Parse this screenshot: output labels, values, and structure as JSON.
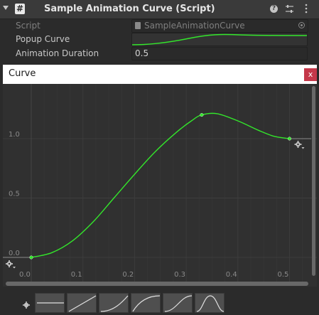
{
  "inspector": {
    "component_title": "Sample Animation Curve (Script)",
    "icons": {
      "collapse": "triangle-down-icon",
      "script": "script-hash-icon",
      "help": "help-icon",
      "presets": "presets-sliders-icon",
      "menu": "kebab-menu-icon"
    }
  },
  "properties": {
    "script_label": "Script",
    "script_value": "SampleAnimationCurve",
    "popup_curve_label": "Popup Curve",
    "duration_label": "Animation Duration",
    "duration_value": "0.5"
  },
  "curve_window": {
    "title": "Curve",
    "close_label": "x",
    "curve_color": "#33e62b"
  },
  "chart_data": {
    "type": "line",
    "x_ticks": [
      "0.0",
      "0.1",
      "0.2",
      "0.3",
      "0.4",
      "0.5"
    ],
    "y_ticks": [
      "0.0",
      "0.5",
      "1.0"
    ],
    "xlim": [
      -0.03,
      0.56
    ],
    "ylim": [
      -0.05,
      1.48
    ],
    "keyframes": [
      {
        "x": 0.0,
        "y": 0.0
      },
      {
        "x": 0.33,
        "y": 1.2
      },
      {
        "x": 0.5,
        "y": 1.0
      }
    ],
    "points": [
      {
        "x": 0.0,
        "y": 0.0
      },
      {
        "x": 0.04,
        "y": 0.04
      },
      {
        "x": 0.08,
        "y": 0.14
      },
      {
        "x": 0.12,
        "y": 0.3
      },
      {
        "x": 0.16,
        "y": 0.5
      },
      {
        "x": 0.2,
        "y": 0.7
      },
      {
        "x": 0.24,
        "y": 0.89
      },
      {
        "x": 0.28,
        "y": 1.05
      },
      {
        "x": 0.31,
        "y": 1.15
      },
      {
        "x": 0.33,
        "y": 1.2
      },
      {
        "x": 0.36,
        "y": 1.21
      },
      {
        "x": 0.4,
        "y": 1.15
      },
      {
        "x": 0.44,
        "y": 1.07
      },
      {
        "x": 0.47,
        "y": 1.02
      },
      {
        "x": 0.5,
        "y": 1.0
      }
    ]
  },
  "presets": {
    "items": [
      "flat",
      "linear",
      "ease-in",
      "ease-out",
      "ease-in-out",
      "bell"
    ],
    "gear_icon": "gear-icon"
  }
}
